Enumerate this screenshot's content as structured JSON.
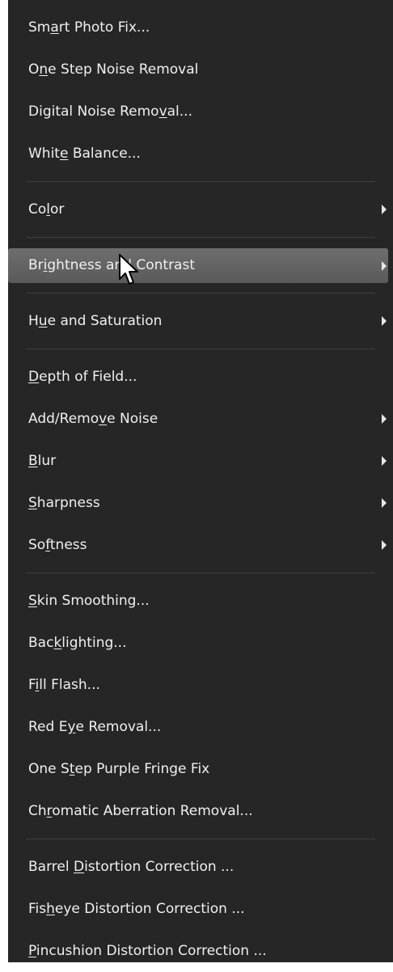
{
  "menu": {
    "groups": [
      [
        {
          "id": "smart-photo-fix",
          "pre": "Sm",
          "u": "a",
          "post": "rt Photo Fix...",
          "submenu": false
        },
        {
          "id": "one-step-noise-removal",
          "pre": "O",
          "u": "n",
          "post": "e Step Noise Removal",
          "submenu": false
        },
        {
          "id": "digital-noise-removal",
          "pre": "Digital Noise Remo",
          "u": "v",
          "post": "al...",
          "submenu": false
        },
        {
          "id": "white-balance",
          "pre": "Whit",
          "u": "e",
          "post": " Balance...",
          "submenu": false
        }
      ],
      [
        {
          "id": "color",
          "pre": "Co",
          "u": "l",
          "post": "or",
          "submenu": true
        }
      ],
      [
        {
          "id": "brightness-and-contrast",
          "pre": "Br",
          "u": "i",
          "post": "ghtness and Contrast",
          "submenu": true,
          "highlighted": true
        }
      ],
      [
        {
          "id": "hue-and-saturation",
          "pre": "H",
          "u": "u",
          "post": "e and Saturation",
          "submenu": true
        }
      ],
      [
        {
          "id": "depth-of-field",
          "pre": "",
          "u": "D",
          "post": "epth of Field...",
          "submenu": false
        },
        {
          "id": "add-remove-noise",
          "pre": "Add/Remo",
          "u": "v",
          "post": "e Noise",
          "submenu": true
        },
        {
          "id": "blur",
          "pre": "",
          "u": "B",
          "post": "lur",
          "submenu": true
        },
        {
          "id": "sharpness",
          "pre": "",
          "u": "S",
          "post": "harpness",
          "submenu": true
        },
        {
          "id": "softness",
          "pre": "So",
          "u": "f",
          "post": "tness",
          "submenu": true
        }
      ],
      [
        {
          "id": "skin-smoothing",
          "pre": "",
          "u": "S",
          "post": "kin Smoothing...",
          "submenu": false
        },
        {
          "id": "backlighting",
          "pre": "Bac",
          "u": "k",
          "post": "lighting...",
          "submenu": false
        },
        {
          "id": "fill-flash",
          "pre": "F",
          "u": "i",
          "post": "ll Flash...",
          "submenu": false
        },
        {
          "id": "red-eye-removal",
          "pre": "Red E",
          "u": "y",
          "post": "e Removal...",
          "submenu": false
        },
        {
          "id": "one-step-purple-fringe-fix",
          "pre": "One S",
          "u": "t",
          "post": "ep Purple Fringe Fix",
          "submenu": false
        },
        {
          "id": "chromatic-aberration-removal",
          "pre": "Ch",
          "u": "r",
          "post": "omatic Aberration Removal...",
          "submenu": false
        }
      ],
      [
        {
          "id": "barrel-distortion-correction",
          "pre": "Barrel ",
          "u": "D",
          "post": "istortion Correction ...",
          "submenu": false
        },
        {
          "id": "fisheye-distortion-correction",
          "pre": "Fis",
          "u": "h",
          "post": "eye Distortion Correction ...",
          "submenu": false
        },
        {
          "id": "pincushion-distortion-correction",
          "pre": "",
          "u": "P",
          "post": "incushion Distortion Correction ...",
          "submenu": false
        }
      ]
    ]
  },
  "colors": {
    "menu_background": "#262626",
    "text": "#f0f0f0",
    "highlight": "#666666",
    "separator": "#3f3f3f"
  },
  "icons": {
    "submenu": "submenu-arrow-icon",
    "cursor": "mouse-pointer-icon"
  }
}
